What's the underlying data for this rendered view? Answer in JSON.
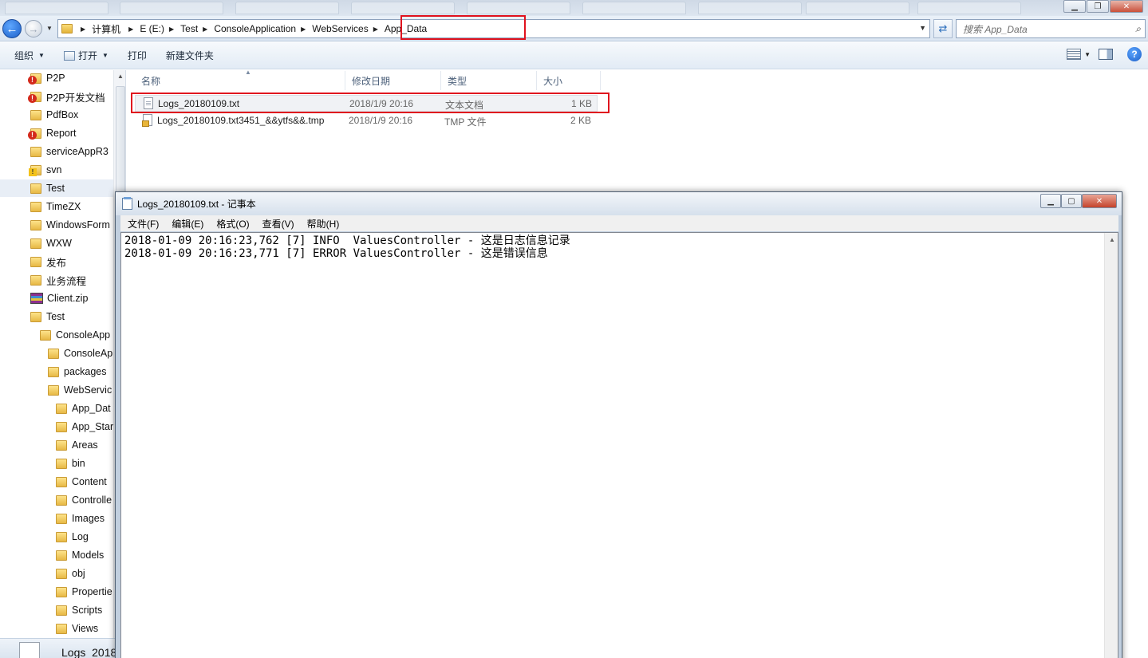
{
  "explorer": {
    "breadcrumb": [
      "计算机",
      "E (E:)",
      "Test",
      "ConsoleApplication",
      "WebServices",
      "App_Data"
    ],
    "search_placeholder": "搜索 App_Data",
    "toolbar": {
      "organize": "组织",
      "open": "打开",
      "print": "打印",
      "new_folder": "新建文件夹"
    },
    "columns": {
      "name": "名称",
      "modified": "修改日期",
      "type": "类型",
      "size": "大小"
    },
    "files": [
      {
        "name": "Logs_20180109.txt",
        "modified": "2018/1/9 20:16",
        "type": "文本文档",
        "size": "1 KB",
        "icon": "text-file-icon"
      },
      {
        "name": "Logs_20180109.txt3451_&&ytfs&&.tmp",
        "modified": "2018/1/9 20:16",
        "type": "TMP 文件",
        "size": "2 KB",
        "icon": "tmp-file-icon"
      }
    ],
    "nav_items": [
      {
        "label": "P2P",
        "icon": "folder-alert-icon"
      },
      {
        "label": "P2P开发文档",
        "icon": "folder-alert-icon"
      },
      {
        "label": "PdfBox",
        "icon": "folder-icon"
      },
      {
        "label": "Report",
        "icon": "folder-alert-icon"
      },
      {
        "label": "serviceAppR3",
        "icon": "folder-icon"
      },
      {
        "label": "svn",
        "icon": "folder-warning-icon"
      },
      {
        "label": "Test",
        "icon": "folder-icon",
        "selected": true
      },
      {
        "label": "TimeZX",
        "icon": "folder-icon"
      },
      {
        "label": "WindowsForm",
        "icon": "folder-icon"
      },
      {
        "label": "WXW",
        "icon": "folder-icon"
      },
      {
        "label": "发布",
        "icon": "folder-icon"
      },
      {
        "label": "业务流程",
        "icon": "folder-icon"
      },
      {
        "label": "Client.zip",
        "icon": "zip-icon"
      },
      {
        "label": "Test",
        "icon": "folder-icon"
      },
      {
        "label": "ConsoleApp",
        "icon": "folder-icon"
      },
      {
        "label": "ConsoleAp",
        "icon": "folder-icon"
      },
      {
        "label": "packages",
        "icon": "folder-icon"
      },
      {
        "label": "WebServic",
        "icon": "folder-icon"
      },
      {
        "label": "App_Dat",
        "icon": "folder-icon"
      },
      {
        "label": "App_Star",
        "icon": "folder-icon"
      },
      {
        "label": "Areas",
        "icon": "folder-icon"
      },
      {
        "label": "bin",
        "icon": "folder-icon"
      },
      {
        "label": "Content",
        "icon": "folder-icon"
      },
      {
        "label": "Controlle",
        "icon": "folder-icon"
      },
      {
        "label": "Images",
        "icon": "folder-icon"
      },
      {
        "label": "Log",
        "icon": "folder-icon"
      },
      {
        "label": "Models",
        "icon": "folder-icon"
      },
      {
        "label": "obj",
        "icon": "folder-icon"
      },
      {
        "label": "Propertie",
        "icon": "folder-icon"
      },
      {
        "label": "Scripts",
        "icon": "folder-icon"
      },
      {
        "label": "Views",
        "icon": "folder-icon"
      }
    ],
    "details_name": "Logs_2018"
  },
  "notepad": {
    "title": "Logs_20180109.txt - 记事本",
    "menu": [
      "文件(F)",
      "编辑(E)",
      "格式(O)",
      "查看(V)",
      "帮助(H)"
    ],
    "content_lines": [
      "2018-01-09 20:16:23,762 [7] INFO  ValuesController - 这是日志信息记录",
      "2018-01-09 20:16:23,771 [7] ERROR ValuesController - 这是错误信息"
    ]
  },
  "colors": {
    "highlight_red": "#e0121e",
    "accent_blue": "#1c5fc8"
  }
}
